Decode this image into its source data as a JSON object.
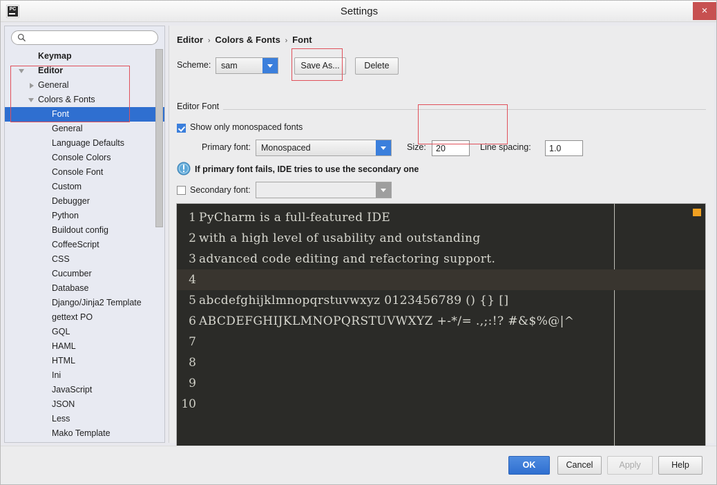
{
  "window": {
    "title": "Settings",
    "logo_text": "PC",
    "close_label": "×"
  },
  "sidebar": {
    "search": {
      "value": "",
      "placeholder": "",
      "icon": "search-icon"
    },
    "items": [
      {
        "label": "Keymap",
        "level": 0,
        "twisty": "none",
        "selected": false
      },
      {
        "label": "Editor",
        "level": 0,
        "twisty": "open",
        "selected": false
      },
      {
        "label": "General",
        "level": 1,
        "twisty": "closed",
        "selected": false
      },
      {
        "label": "Colors & Fonts",
        "level": 1,
        "twisty": "open",
        "selected": false
      },
      {
        "label": "Font",
        "level": 2,
        "twisty": "none",
        "selected": true
      },
      {
        "label": "General",
        "level": 2,
        "twisty": "none",
        "selected": false
      },
      {
        "label": "Language Defaults",
        "level": 2,
        "twisty": "none",
        "selected": false
      },
      {
        "label": "Console Colors",
        "level": 2,
        "twisty": "none",
        "selected": false
      },
      {
        "label": "Console Font",
        "level": 2,
        "twisty": "none",
        "selected": false
      },
      {
        "label": "Custom",
        "level": 2,
        "twisty": "none",
        "selected": false
      },
      {
        "label": "Debugger",
        "level": 2,
        "twisty": "none",
        "selected": false
      },
      {
        "label": "Python",
        "level": 2,
        "twisty": "none",
        "selected": false
      },
      {
        "label": "Buildout config",
        "level": 2,
        "twisty": "none",
        "selected": false
      },
      {
        "label": "CoffeeScript",
        "level": 2,
        "twisty": "none",
        "selected": false
      },
      {
        "label": "CSS",
        "level": 2,
        "twisty": "none",
        "selected": false
      },
      {
        "label": "Cucumber",
        "level": 2,
        "twisty": "none",
        "selected": false
      },
      {
        "label": "Database",
        "level": 2,
        "twisty": "none",
        "selected": false
      },
      {
        "label": "Django/Jinja2 Template",
        "level": 2,
        "twisty": "none",
        "selected": false
      },
      {
        "label": "gettext PO",
        "level": 2,
        "twisty": "none",
        "selected": false
      },
      {
        "label": "GQL",
        "level": 2,
        "twisty": "none",
        "selected": false
      },
      {
        "label": "HAML",
        "level": 2,
        "twisty": "none",
        "selected": false
      },
      {
        "label": "HTML",
        "level": 2,
        "twisty": "none",
        "selected": false
      },
      {
        "label": "Ini",
        "level": 2,
        "twisty": "none",
        "selected": false
      },
      {
        "label": "JavaScript",
        "level": 2,
        "twisty": "none",
        "selected": false
      },
      {
        "label": "JSON",
        "level": 2,
        "twisty": "none",
        "selected": false
      },
      {
        "label": "Less",
        "level": 2,
        "twisty": "none",
        "selected": false
      },
      {
        "label": "Mako Template",
        "level": 2,
        "twisty": "none",
        "selected": false
      }
    ]
  },
  "panel": {
    "breadcrumb": {
      "part1": "Editor",
      "sep1": "›",
      "part2": "Colors & Fonts",
      "sep2": "›",
      "part3": "Font"
    },
    "scheme_label": "Scheme:",
    "scheme_value": "sam",
    "save_as_label": "Save As...",
    "delete_label": "Delete",
    "group_title": "Editor Font",
    "monospaced_label": "Show only monospaced fonts",
    "monospaced_checked": true,
    "primary_font_label": "Primary font:",
    "primary_font_value": "Monospaced",
    "size_label": "Size:",
    "size_value": "20",
    "line_spacing_label": "Line spacing:",
    "line_spacing_value": "1.0",
    "info_text": "If primary font fails, IDE tries to use the secondary one",
    "info_icon": "info-circle-icon",
    "secondary_label": "Secondary font:",
    "secondary_checked": false,
    "secondary_value": ""
  },
  "preview": {
    "background": "#2b2b28",
    "text_color": "#d8d8d0",
    "highlight_color": "#39352f",
    "marker_color": "#f0a021",
    "lines": [
      {
        "n": "1",
        "text": "PyCharm is a full-featured IDE",
        "highlight": false
      },
      {
        "n": "2",
        "text": "with a high level of usability and outstanding",
        "highlight": false
      },
      {
        "n": "3",
        "text": "advanced code editing and refactoring support.",
        "highlight": false
      },
      {
        "n": "4",
        "text": "",
        "highlight": true
      },
      {
        "n": "5",
        "text": "abcdefghijklmnopqrstuvwxyz 0123456789 () {} []",
        "highlight": false
      },
      {
        "n": "6",
        "text": "ABCDEFGHIJKLMNOPQRSTUVWXYZ +-*/= .,;:!? #&$%@|^",
        "highlight": false
      },
      {
        "n": "7",
        "text": "",
        "highlight": false
      },
      {
        "n": "8",
        "text": "",
        "highlight": false
      },
      {
        "n": "9",
        "text": "",
        "highlight": false
      },
      {
        "n": "10",
        "text": "",
        "highlight": false
      }
    ]
  },
  "footer": {
    "ok": "OK",
    "cancel": "Cancel",
    "apply": "Apply",
    "help": "Help"
  },
  "annotations": {
    "color": "#e0505a",
    "boxes": [
      "tree-editor-font-highlight",
      "save-as-highlight",
      "size-field-highlight"
    ]
  }
}
